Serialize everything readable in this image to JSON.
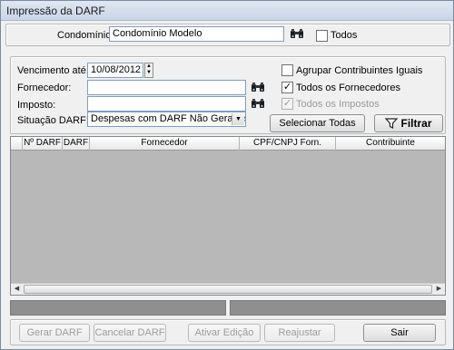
{
  "window": {
    "title": "Impressão da DARF"
  },
  "condominio": {
    "label": "Condomínio:",
    "value": "Condomínio Modelo",
    "todos_label": "Todos",
    "todos_checked": false
  },
  "filters": {
    "vencimento_label": "Vencimento até:",
    "vencimento_value": "10/08/2012",
    "fornecedor_label": "Fornecedor:",
    "fornecedor_value": "",
    "imposto_label": "Imposto:",
    "imposto_value": "",
    "situacao_label": "Situação DARF:",
    "situacao_value": "Despesas com DARF Não Geradas"
  },
  "options": {
    "agrupar_label": "Agrupar Contribuintes Iguais",
    "agrupar_checked": false,
    "todos_fornecedores_label": "Todos os Fornecedores",
    "todos_fornecedores_checked": true,
    "todos_impostos_label": "Todos os Impostos",
    "todos_impostos_checked": true
  },
  "buttons": {
    "selecionar_todas": "Selecionar Todas",
    "filtrar": "Filtrar",
    "gerar_darf": "Gerar DARF",
    "cancelar_darf": "Cancelar DARF",
    "ativar_edicao": "Ativar Edição",
    "reajustar": "Reajustar",
    "sair": "Sair"
  },
  "grid": {
    "columns": [
      "",
      "Nº DARF",
      "DARF",
      "Fornecedor",
      "CPF/CNPJ Forn.",
      "Contribuinte"
    ]
  },
  "icons": {
    "search": "binoculars-icon",
    "filter": "funnel-icon"
  }
}
